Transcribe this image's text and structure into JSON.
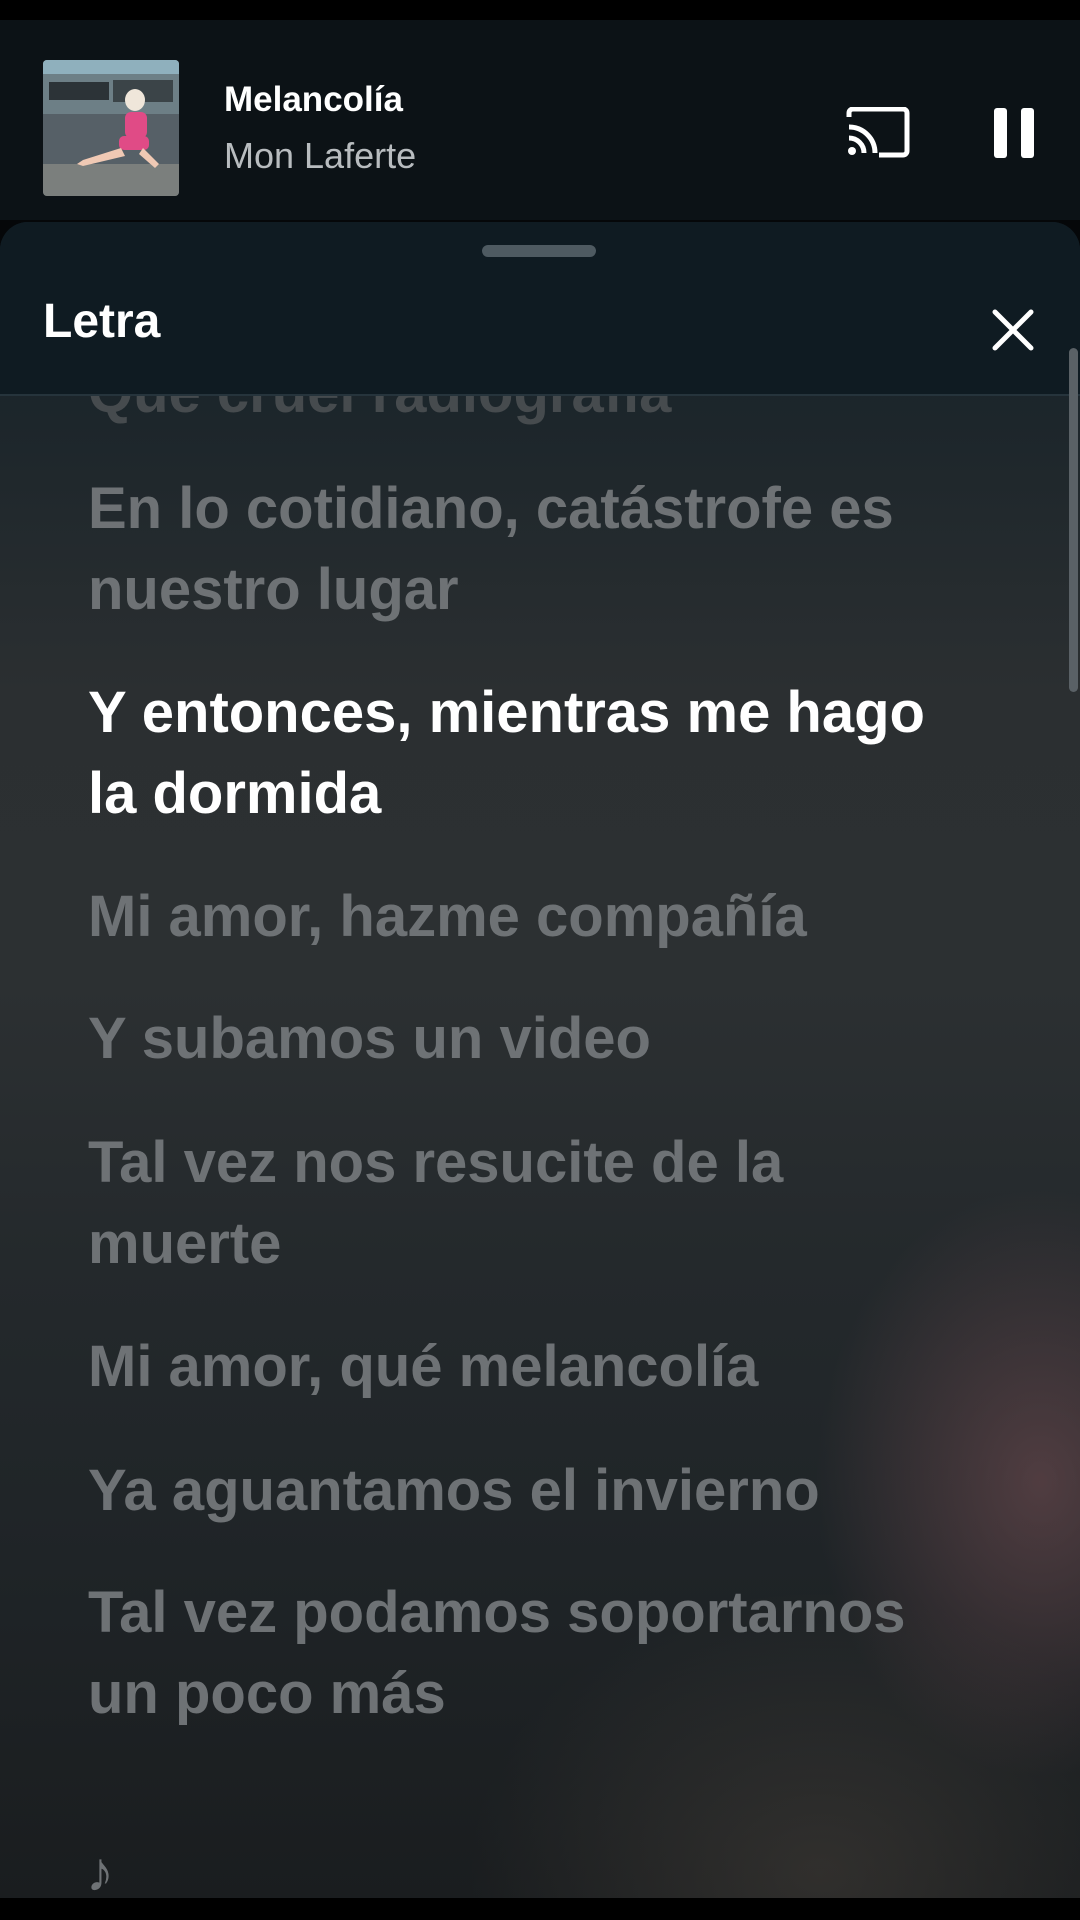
{
  "miniplayer": {
    "title": "Melancolía",
    "artist": "Mon Laferte"
  },
  "sheet": {
    "title": "Letra"
  },
  "lyrics": [
    {
      "text": "Qué cruel radiografía",
      "state": "faded"
    },
    {
      "text": "En lo cotidiano, catástrofe es nuestro lugar",
      "state": "upcoming"
    },
    {
      "text": "Y entonces, mientras me hago la dormida",
      "state": "active"
    },
    {
      "text": "Mi amor, hazme compañía",
      "state": "upcoming"
    },
    {
      "text": "Y subamos un video",
      "state": "upcoming"
    },
    {
      "text": "Tal vez nos resucite de la muerte",
      "state": "upcoming"
    },
    {
      "text": "Mi amor, qué melancolía",
      "state": "upcoming"
    },
    {
      "text": "Ya aguantamos el invierno",
      "state": "upcoming"
    },
    {
      "text": "Tal vez podamos soportarnos un poco más",
      "state": "upcoming"
    }
  ],
  "music_note": "♪",
  "icons": {
    "album_art": "album-art-image",
    "cast": "cast-icon",
    "pause": "pause-icon",
    "close": "close-icon",
    "note": "music-note-icon"
  }
}
